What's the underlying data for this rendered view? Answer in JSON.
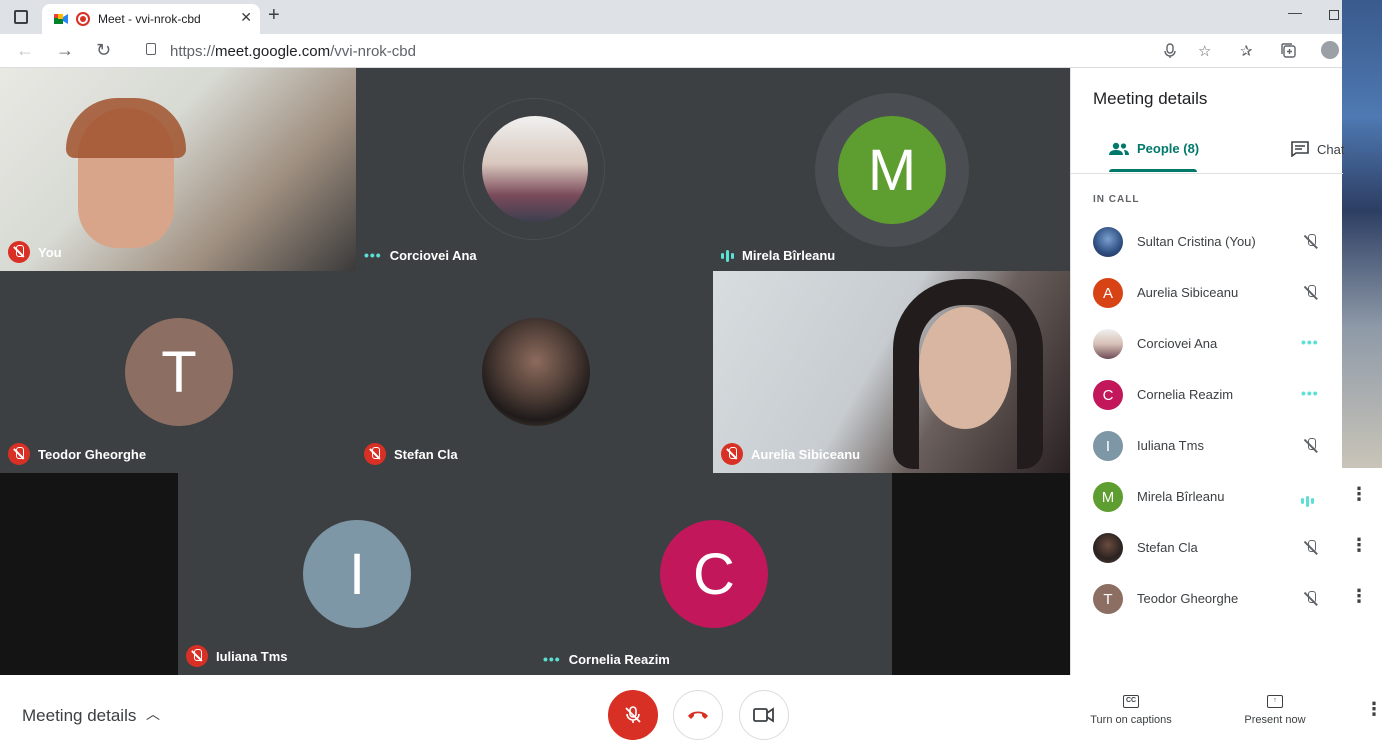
{
  "browser": {
    "tab_title": "Meet - vvi-nrok-cbd",
    "url_prefix": "https://",
    "url_host": "meet.google.com",
    "url_path": "/vvi-nrok-cbd",
    "icons": [
      "sidebar-icon",
      "meet-favicon",
      "recording-icon",
      "close-icon",
      "new-tab-icon",
      "back-icon",
      "forward-icon",
      "reload-icon",
      "lock-icon",
      "microphone-icon",
      "add-favorite-icon",
      "favorites-icon",
      "collections-icon",
      "profile-icon",
      "minimize-icon",
      "maximize-icon"
    ]
  },
  "tiles": [
    {
      "name": "You",
      "status": "muted",
      "kind": "video"
    },
    {
      "name": "Corciovei Ana",
      "status": "dots",
      "kind": "photo-avatar"
    },
    {
      "name": "Mirela Bîrleanu",
      "status": "speaking",
      "kind": "letter",
      "letter": "M",
      "color": "#5e9d2f"
    },
    {
      "name": "Teodor Gheorghe",
      "status": "muted",
      "kind": "letter",
      "letter": "T",
      "color": "#8d6e63"
    },
    {
      "name": "Stefan Cla",
      "status": "muted",
      "kind": "photo-avatar"
    },
    {
      "name": "Aurelia Sibiceanu",
      "status": "muted",
      "kind": "video"
    },
    {
      "name": "Iuliana Tms",
      "status": "muted",
      "kind": "letter",
      "letter": "I",
      "color": "#7e97a6"
    },
    {
      "name": "Cornelia Reazim",
      "status": "dots",
      "kind": "letter",
      "letter": "C",
      "color": "#c2185b"
    }
  ],
  "panel": {
    "title": "Meeting details",
    "tab_people": "People (8)",
    "tab_chat": "Chat",
    "section": "IN CALL",
    "people": [
      {
        "name": "Sultan Cristina (You)",
        "letter": "",
        "color": "#4a6fa5",
        "status": "muted"
      },
      {
        "name": "Aurelia Sibiceanu",
        "letter": "A",
        "color": "#d84315",
        "status": "muted"
      },
      {
        "name": "Corciovei Ana",
        "letter": "",
        "color": "#b39a93",
        "status": "dots"
      },
      {
        "name": "Cornelia Reazim",
        "letter": "C",
        "color": "#c2185b",
        "status": "dots"
      },
      {
        "name": "Iuliana Tms",
        "letter": "I",
        "color": "#7e97a6",
        "status": "muted"
      },
      {
        "name": "Mirela Bîrleanu",
        "letter": "M",
        "color": "#5e9d2f",
        "status": "speaking"
      },
      {
        "name": "Stefan Cla",
        "letter": "",
        "color": "#3a3330",
        "status": "muted"
      },
      {
        "name": "Teodor Gheorghe",
        "letter": "T",
        "color": "#8d6e63",
        "status": "muted"
      }
    ]
  },
  "bottom": {
    "meeting_details": "Meeting details",
    "captions": "Turn on captions",
    "present": "Present now",
    "cc": "CC"
  },
  "colors": {
    "accent": "#00796b",
    "danger": "#d93025",
    "speaking": "#5ce0d6",
    "tile_bg": "#3c4043",
    "grid_bg": "#202124"
  }
}
